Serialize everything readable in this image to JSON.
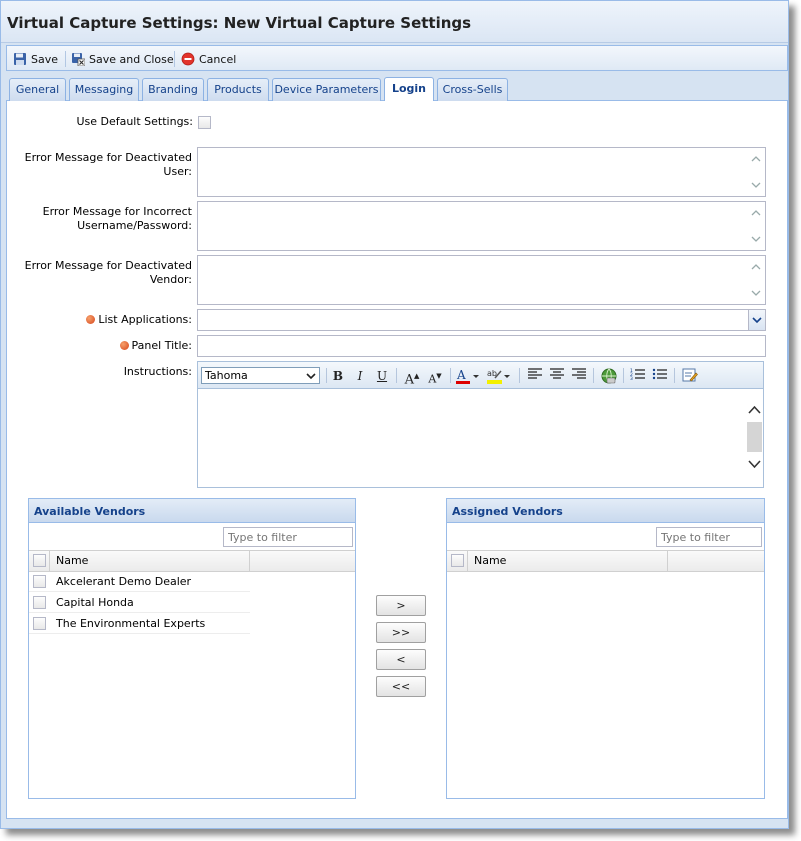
{
  "window": {
    "title": "Virtual Capture Settings: New Virtual Capture Settings"
  },
  "toolbar": {
    "save_label": "Save",
    "save_close_label": "Save and Close",
    "cancel_label": "Cancel"
  },
  "tabs": [
    {
      "label": "General"
    },
    {
      "label": "Messaging"
    },
    {
      "label": "Branding"
    },
    {
      "label": "Products"
    },
    {
      "label": "Device Parameters"
    },
    {
      "label": "Login",
      "active": true
    },
    {
      "label": "Cross-Sells"
    }
  ],
  "form": {
    "use_default_label": "Use Default Settings:",
    "deactivated_user_label": "Error Message for Deactivated User:",
    "incorrect_login_label": "Error Message for Incorrect Username/Password:",
    "deactivated_vendor_label": "Error Message for Deactivated Vendor:",
    "list_apps_label": "List Applications:",
    "panel_title_label": "Panel Title:",
    "instructions_label": "Instructions:",
    "font_value": "Tahoma"
  },
  "available": {
    "title": "Available Vendors",
    "filter_placeholder": "Type to filter",
    "column_name": "Name",
    "rows": [
      "Akcelerant Demo Dealer",
      "Capital Honda",
      "The Environmental Experts"
    ]
  },
  "assigned": {
    "title": "Assigned Vendors",
    "filter_placeholder": "Type to filter",
    "column_name": "Name",
    "rows": []
  },
  "move_buttons": {
    "add": ">",
    "add_all": ">>",
    "remove": "<",
    "remove_all": "<<"
  },
  "colors": {
    "accent": "#15428b",
    "border": "#99bbe8",
    "required": "#d6451b"
  }
}
